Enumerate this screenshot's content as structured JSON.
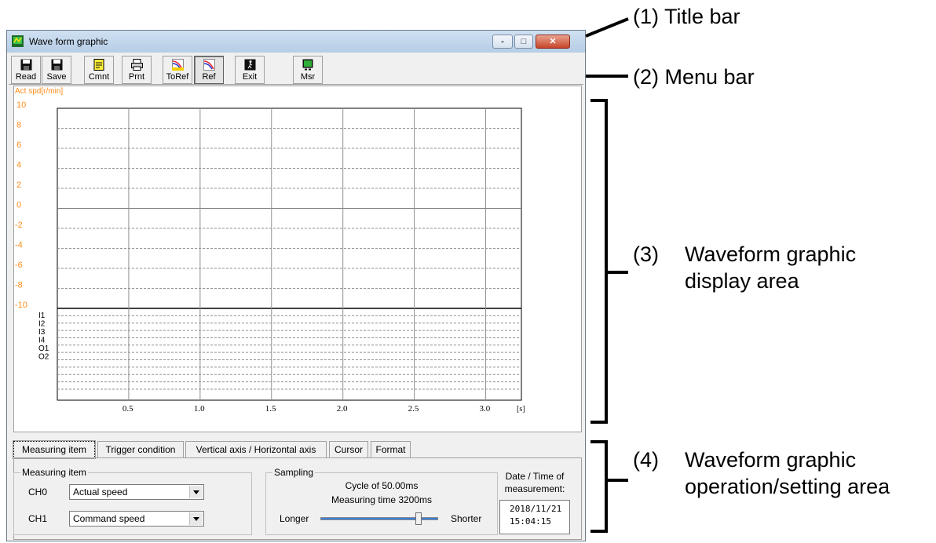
{
  "window": {
    "title": "Wave form graphic",
    "controls": {
      "minimize": "-",
      "maximize": "□",
      "close": "✕"
    }
  },
  "toolbar": {
    "buttons": [
      {
        "label": "Read",
        "icon": "floppy-icon"
      },
      {
        "label": "Save",
        "icon": "floppy-icon"
      },
      {
        "label": "Cmnt",
        "icon": "note-icon"
      },
      {
        "label": "Prnt",
        "icon": "printer-icon"
      },
      {
        "label": "ToRef",
        "icon": "to-reference-icon"
      },
      {
        "label": "Ref",
        "icon": "reference-icon",
        "pressed": true
      },
      {
        "label": "Exit",
        "icon": "exit-icon"
      },
      {
        "label": "Msr",
        "icon": "measure-icon"
      }
    ]
  },
  "graph": {
    "y_title": "Act spd[r/min]",
    "y_ticks": [
      "10",
      "8",
      "6",
      "4",
      "2",
      "0",
      "-2",
      "-4",
      "-6",
      "-8",
      "-10"
    ],
    "digital_labels": [
      "I1",
      "I2",
      "I3",
      "I4",
      "O1",
      "O2"
    ],
    "x_ticks": [
      "0.5",
      "1.0",
      "1.5",
      "2.0",
      "2.5",
      "3.0"
    ],
    "x_unit": "[s]",
    "colors": {
      "analog_label": "#ff8c1a",
      "grid": "#808080",
      "axis": "#000000"
    }
  },
  "tabs": [
    "Measuring item",
    "Trigger condition",
    "Vertical axis / Horizontal axis",
    "Cursor",
    "Format"
  ],
  "measuring": {
    "group_title": "Measuring item",
    "ch0_label": "CH0",
    "ch0_value": "Actual speed",
    "ch1_label": "CH1",
    "ch1_value": "Command speed"
  },
  "sampling": {
    "group_title": "Sampling",
    "cycle": "Cycle of 50.00ms",
    "measuring_time": "Measuring time 3200ms",
    "longer": "Longer",
    "shorter": "Shorter",
    "slider_level": 0.85
  },
  "datetime": {
    "label_line1": "Date / Time of",
    "label_line2": "measurement:",
    "date": "2018/11/21",
    "time": "15:04:15"
  },
  "annotations": {
    "title_bar": "(1) Title bar",
    "menu_bar": "(2) Menu bar",
    "display_num": "(3)",
    "display_line1": "Waveform graphic",
    "display_line2": "display area",
    "operation_num": "(4)",
    "operation_line1": "Waveform graphic",
    "operation_line2": "operation/setting area"
  }
}
